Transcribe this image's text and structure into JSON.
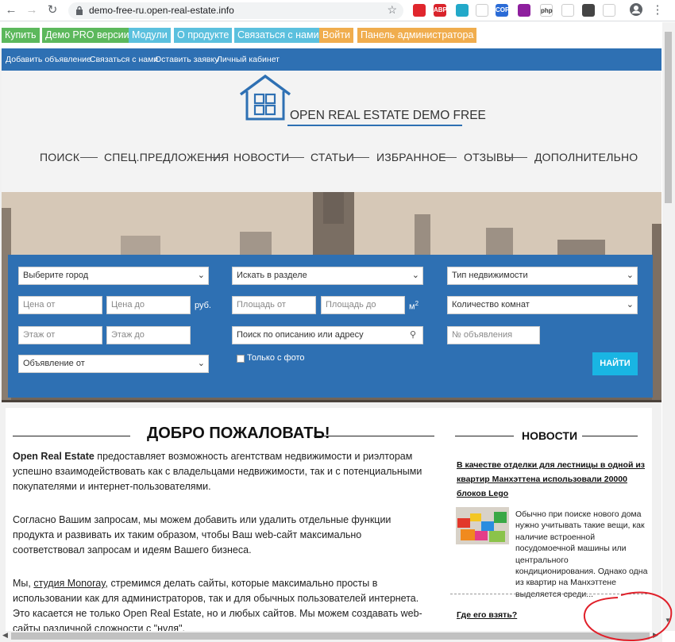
{
  "browser": {
    "url": "demo-free-ru.open-real-estate.info",
    "extensions": [
      {
        "name": "opera-icon",
        "color": "#e0262d",
        "label": ""
      },
      {
        "name": "adblock-icon",
        "color": "#d9232b",
        "label": "ABP"
      },
      {
        "name": "ghost-icon",
        "color": "#23a9c9",
        "label": ""
      },
      {
        "name": "cloud-icon",
        "color": "#ffffff",
        "label": ""
      },
      {
        "name": "copy-icon",
        "color": "#2a6bd6",
        "label": "COPY"
      },
      {
        "name": "puzzle-dots-icon",
        "color": "#8e1f9e",
        "label": ""
      },
      {
        "name": "php-icon",
        "color": "#ffffff",
        "label": "php"
      },
      {
        "name": "bolt-icon",
        "color": "#ffffff",
        "label": ""
      },
      {
        "name": "mask-icon",
        "color": "#444444",
        "label": ""
      },
      {
        "name": "radio-icon",
        "color": "#ffffff",
        "label": ""
      }
    ]
  },
  "topbar": {
    "buttons": [
      {
        "label": "Купить",
        "color": "#5cb85c"
      },
      {
        "label": "Демо PRO версии",
        "color": "#5cb85c"
      },
      {
        "label": "Модули",
        "color": "#5bc0de"
      },
      {
        "label": "О продукте",
        "color": "#5bc0de"
      },
      {
        "label": "Связаться с нами",
        "color": "#5bc0de"
      },
      {
        "label": "Войти",
        "color": "#f0ad4e"
      },
      {
        "label": "Панель администратора",
        "color": "#f0ad4e"
      }
    ]
  },
  "subnav": [
    "Добавить объявление",
    "Связаться с нами",
    "Оставить заявку",
    "Личный кабинет"
  ],
  "logo": {
    "text": "OPEN REAL ESTATE DEMO FREE"
  },
  "main_menu": [
    "ПОИСК",
    "СПЕЦ.ПРЕДЛОЖЕНИЯ",
    "НОВОСТИ",
    "СТАТЬИ",
    "ИЗБРАННОЕ",
    "ОТЗЫВЫ",
    "ДОПОЛНИТЕЛЬНО"
  ],
  "search": {
    "city_select": "Выберите город",
    "section_select": "Искать в разделе",
    "type_select": "Тип недвижимости",
    "price_from": "Цена от",
    "price_to": "Цена до",
    "currency": "руб.",
    "area_from": "Площадь от",
    "area_to": "Площадь до",
    "area_unit": "м",
    "area_unit_sup": "2",
    "rooms_select": "Количество комнат",
    "floor_from": "Этаж от",
    "floor_to": "Этаж до",
    "description_search": "Поиск по описанию или адресу",
    "listing_number": "№ объявления",
    "listing_from_select": "Объявление от",
    "photo_only": "Только с фото",
    "find_button": "НАЙТИ"
  },
  "welcome": {
    "title": "ДОБРО ПОЖАЛОВАТЬ!",
    "p1_bold": "Open Real Estate",
    "p1_rest": " предоставляет возможность агентствам недвижимости и риэлторам успешно взаимодействовать как с владельцами недвижимости, так и с потенциальными покупателями и интернет-пользователями.",
    "p2": "Согласно Вашим запросам, мы можем добавить или удалить отдельные функции продукта и развивать их таким образом, чтобы Ваш web-сайт максимально соответствовал запросам и идеям Вашего бизнеса.",
    "p3_start": "Мы, ",
    "p3_link": "студия Monoray",
    "p3_rest": ", стремимся делать сайты, которые максимально просты в использовании как для администраторов, так и для обычных пользователей интернета. Это касается не только Open Real Estate, но и любых сайтов. Мы можем создавать web-сайты различной сложности с \"нуля\"."
  },
  "news": {
    "title": "НОВОСТИ",
    "item1_title": "В качестве отделки для лестницы в одной из квартир Манхэттена использовали 20000 блоков Lego",
    "item1_text": "Обычно при поиске нового дома нужно учитывать такие вещи, как наличие встроенной посудомоечной машины или центрального кондиционирования. Однако одна из квартир на Манхэттене выделяется среди...",
    "item2_title": "Где его взять?"
  },
  "colors": {
    "brand_blue": "#2e70b3",
    "find_button": "#19b5e3",
    "annotation_red": "#e0202a"
  }
}
